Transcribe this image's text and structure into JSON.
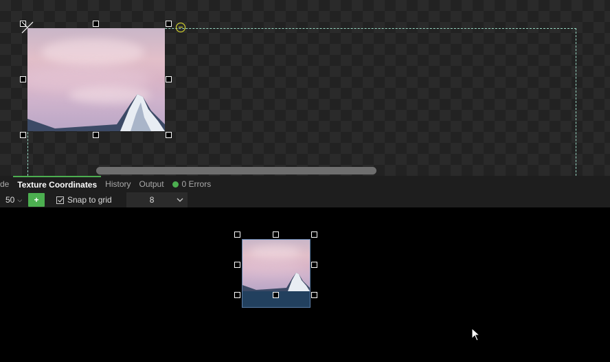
{
  "tabs": [
    {
      "label": "de",
      "active": false
    },
    {
      "label": "Texture Coordinates",
      "active": true
    },
    {
      "label": "History",
      "active": false
    },
    {
      "label": "Output",
      "active": false
    }
  ],
  "status": {
    "errors_label": "0 Errors",
    "color": "#4caf50"
  },
  "toolbar": {
    "zoom_value": "50",
    "add_label": "+",
    "snap_label": "Snap to grid",
    "snap_checked": true,
    "grid_size": "8"
  },
  "icons": {
    "zoom_chevron": "chevron-down-icon",
    "grid_chevron": "chevron-down-icon",
    "origin": "origin-marker-icon",
    "pivot": "pivot-cross-icon",
    "cursor": "mouse-pointer-icon"
  },
  "colors": {
    "accent": "#4caf50",
    "bounds": "#9adbc6",
    "origin": "#e6e62a",
    "uv_fill": "#22405e"
  }
}
